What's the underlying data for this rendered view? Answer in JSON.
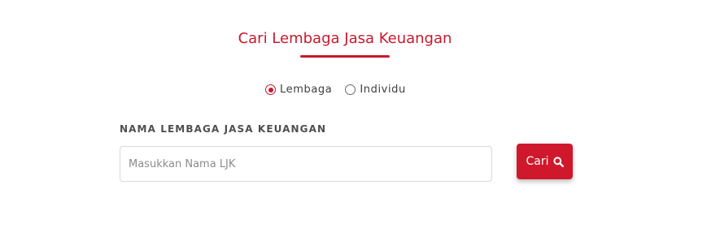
{
  "title": "Cari Lembaga Jasa Keuangan",
  "search_type": {
    "options": [
      {
        "label": "Lembaga",
        "selected": true
      },
      {
        "label": "Individu",
        "selected": false
      }
    ]
  },
  "field": {
    "label": "NAMA LEMBAGA JASA KEUANGAN",
    "value": "",
    "placeholder": "Masukkan Nama LJK"
  },
  "search_button": {
    "label": "Cari",
    "icon": "search-icon"
  },
  "colors": {
    "accent": "#c8192d",
    "button": "#d0182c"
  }
}
